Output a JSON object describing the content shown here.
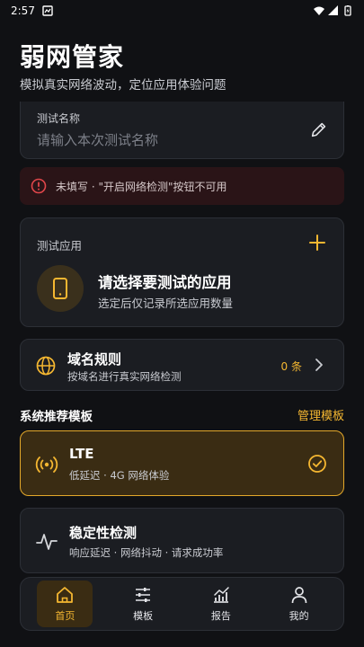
{
  "status_bar": {
    "time": "2:57"
  },
  "header": {
    "title": "弱网管家",
    "subtitle": "模拟真实网络波动，定位应用体验问题"
  },
  "test_name": {
    "label": "测试名称",
    "placeholder": "请输入本次测试名称",
    "value": ""
  },
  "warning": {
    "text": "未填写 · \"开启网络检测\"按钮不可用"
  },
  "test_app": {
    "label": "测试应用",
    "title": "请选择要测试的应用",
    "subtitle": "选定后仅记录所选应用数量"
  },
  "domain_rules": {
    "title": "域名规则",
    "subtitle": "按域名进行真实网络检测",
    "count": "0 条"
  },
  "templates_section": {
    "title": "系统推荐模板",
    "manage_link": "管理模板"
  },
  "templates": [
    {
      "title": "LTE",
      "subtitle": "低延迟 · 4G 网络体验",
      "selected": true
    },
    {
      "title": "稳定性检测",
      "subtitle": "响应延迟 · 网络抖动 · 请求成功率",
      "selected": false
    }
  ],
  "bottom_nav": [
    {
      "label": "首页",
      "icon": "home-icon",
      "active": true
    },
    {
      "label": "模板",
      "icon": "sliders-icon",
      "active": false
    },
    {
      "label": "报告",
      "icon": "chart-icon",
      "active": false
    },
    {
      "label": "我的",
      "icon": "person-icon",
      "active": false
    }
  ],
  "colors": {
    "background": "#101114",
    "card": "#1b1d22",
    "accent": "#f5b731",
    "warning_bg": "#2a1417",
    "warning_icon": "#e0464a"
  }
}
